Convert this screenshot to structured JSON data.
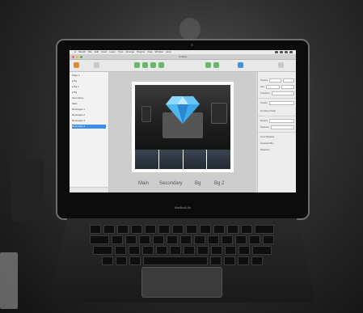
{
  "menubar": {
    "items": [
      "Sketch",
      "File",
      "Edit",
      "Insert",
      "Layer",
      "Type",
      "Arrange",
      "Plugins",
      "View",
      "Window",
      "Help"
    ]
  },
  "window": {
    "title": "Untitled"
  },
  "layers": {
    "items": [
      {
        "label": "Page 1",
        "selected": false
      },
      {
        "label": "▸ Bg",
        "selected": false
      },
      {
        "label": "▸ Bg 2",
        "selected": false
      },
      {
        "label": "▸ Bg",
        "selected": false
      },
      {
        "label": "Secondary",
        "selected": false
      },
      {
        "label": "Main",
        "selected": false
      },
      {
        "label": "Rectangle 1",
        "selected": false
      },
      {
        "label": "Rectangle 2",
        "selected": false
      },
      {
        "label": "Rectangle 3",
        "selected": false
      },
      {
        "label": "Rectangle 4",
        "selected": true
      }
    ]
  },
  "canvas": {
    "thumb_labels": [
      "Main",
      "Secondary",
      "Bg",
      "Bg 2"
    ]
  },
  "inspector": {
    "rows": [
      "Position",
      "Size",
      "Transform",
      "Opacity",
      "No Shared Style",
      "Borders",
      "Shadows",
      "Inner Shadows",
      "Gaussian Blur",
      "Reflection"
    ]
  },
  "colors": {
    "accent": "#3d8fe8",
    "gem": "#4fb6f0",
    "close": "#ff5f57",
    "minimize": "#febc2e",
    "zoom": "#28c840"
  },
  "laptop": {
    "brand": "MacBook Air"
  }
}
